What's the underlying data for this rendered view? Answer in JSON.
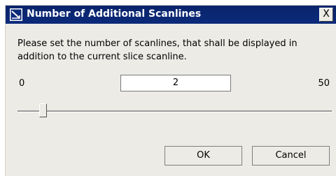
{
  "window": {
    "title": "Number of Additional Scanlines",
    "close_label": "X"
  },
  "message": "Please set the number of scanlines, that shall be displayed in addition to the current slice scanline.",
  "range": {
    "min_label": "0",
    "max_label": "50",
    "min": 0,
    "max": 50
  },
  "value_field": {
    "value": "2"
  },
  "slider": {
    "value": 2
  },
  "buttons": {
    "ok": "OK",
    "cancel": "Cancel"
  }
}
